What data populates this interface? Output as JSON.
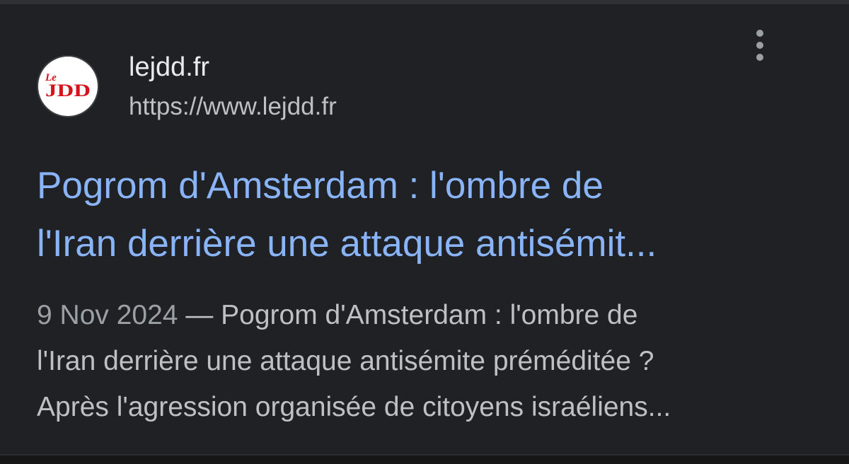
{
  "result": {
    "site_name": "lejdd.fr",
    "site_url": "https://www.lejdd.fr",
    "favicon": {
      "icon": "le-jdd-logo",
      "text_top": "Le",
      "text_main": "JDD",
      "color": "#d5131b"
    },
    "more_icon": "more-vert-icon",
    "title_lines": [
      "Pogrom d'Amsterdam : l'ombre de",
      "l'Iran derrière une attaque antisémit..."
    ],
    "snippet": {
      "date": "9 Nov 2024",
      "separator": " — ",
      "line1_text": "Pogrom d'Amsterdam : l'ombre de",
      "line2": "l'Iran derrière une attaque antisémite préméditée ?",
      "line3": "Après l'agression organisée de citoyens israéliens..."
    }
  },
  "colors": {
    "background": "#202124",
    "title": "#8ab4f8",
    "text": "#bdc1c6",
    "site_name": "#e8eaed"
  }
}
